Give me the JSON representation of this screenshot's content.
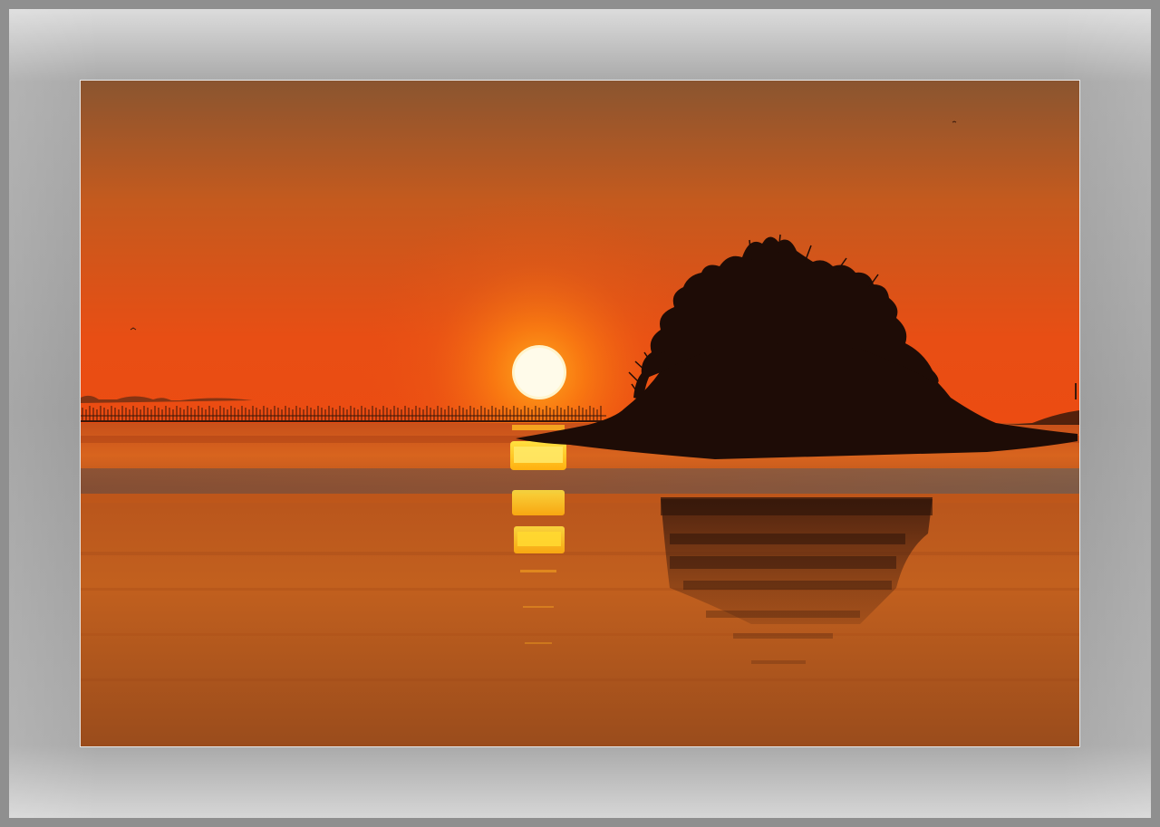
{
  "image": {
    "subject": "sunset-over-sea-with-tree-island",
    "colors": {
      "frame": "#9b9b9b",
      "mat_border": "#e9e9e9",
      "sky_top": "#8a5230",
      "sky_mid": "#d6561a",
      "sky_horizon": "#ea4a12",
      "sun": "#fff6d6",
      "sun_glow": "#ff8a10",
      "water": "#c45a1a",
      "water_dark": "#7a3a14",
      "silhouette": "#1e0c06"
    }
  }
}
